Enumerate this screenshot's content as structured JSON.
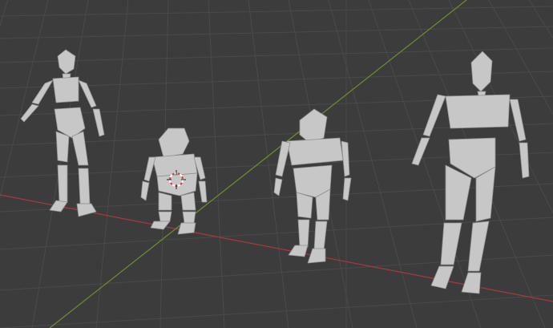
{
  "viewport": {
    "background": "#3c3c3c",
    "grid_color": "#4a4a4a",
    "x_axis_color": "#a83a3a",
    "y_axis_color": "#6a8f2f",
    "figure_color": "#c7c7c7"
  },
  "scene": {
    "objects": [
      {
        "name": "mannequin-slim"
      },
      {
        "name": "mannequin-small"
      },
      {
        "name": "mannequin-medium"
      },
      {
        "name": "mannequin-tall"
      }
    ],
    "cursor": {
      "name": "3d-cursor-icon"
    }
  }
}
